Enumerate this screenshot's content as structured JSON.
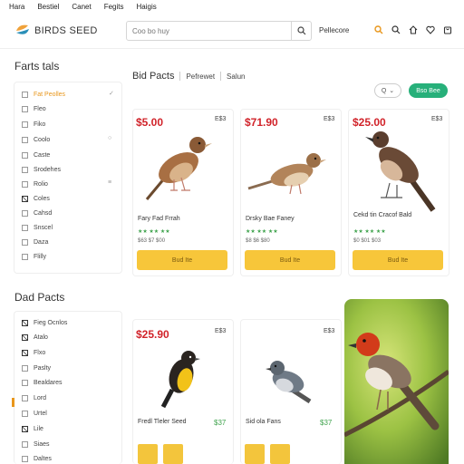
{
  "topnav": [
    "Hara",
    "Bestiel",
    "Canet",
    "Fegits",
    "Haigis"
  ],
  "header": {
    "logo_text": "BIRDS SEED",
    "search_placeholder": "Coo bo huy",
    "link": "Pellecore"
  },
  "filters1": {
    "title": "Farts tals",
    "items": [
      {
        "label": "Fat Peolles",
        "checked": false,
        "active": true,
        "extra": "✓"
      },
      {
        "label": "Fleo",
        "checked": false
      },
      {
        "label": "Fiko",
        "checked": false
      },
      {
        "label": "Coolo",
        "checked": false,
        "extra": "○"
      },
      {
        "label": "Caste",
        "checked": false
      },
      {
        "label": "Srodehes",
        "checked": false
      },
      {
        "label": "Rolio",
        "checked": false,
        "extra": "≡"
      },
      {
        "label": "Coles",
        "checked": true
      },
      {
        "label": "Cahsd",
        "checked": false
      },
      {
        "label": "Snscel",
        "checked": false
      },
      {
        "label": "Daza",
        "checked": false
      },
      {
        "label": "Flilly",
        "checked": false
      }
    ]
  },
  "tabs": {
    "main": "Bid Pacts",
    "items": [
      "Pefrewet",
      "Salun"
    ]
  },
  "sort_label": "Q",
  "pill_label": "Bso Bee",
  "products_row1": [
    {
      "price": "$5.00",
      "code": "E$3",
      "name": "Fary Fad Frrah",
      "rating": "★★ ★★ ★★",
      "meta": "$63 $7 $00",
      "buy": "Bud Ite"
    },
    {
      "price": "$71.90",
      "code": "E$3",
      "name": "Drsky Bae Faney",
      "rating": "★★ ★★ ★★",
      "meta": "$8 $6 $80",
      "buy": "Bud Ite"
    },
    {
      "price": "$25.00",
      "code": "E$3",
      "name": "Cekd tin Cracof Bald",
      "rating": "★★ ★★ ★★",
      "meta": "$0 $01 $03",
      "buy": "Bud Ite"
    }
  ],
  "filters2": {
    "title": "Dad Pacts",
    "items": [
      {
        "label": "Fieg Ocnlos",
        "checked": true
      },
      {
        "label": "Atalo",
        "checked": true
      },
      {
        "label": "Flxo",
        "checked": true
      },
      {
        "label": "Paslty",
        "checked": false
      },
      {
        "label": "Bealdares",
        "checked": false
      },
      {
        "label": "Lord",
        "checked": false
      },
      {
        "label": "Urtel",
        "checked": false
      },
      {
        "label": "Lile",
        "checked": true
      },
      {
        "label": "Siaes",
        "checked": false
      },
      {
        "label": "Daltes",
        "checked": false
      }
    ]
  },
  "products_row2": [
    {
      "price": "$25.90",
      "code": "E$3",
      "name": "Fredl Tleler Seed",
      "side_price": "$37"
    },
    {
      "price": "",
      "code": "E$3",
      "name": "Sid ola Fans",
      "side_price": "$37"
    }
  ],
  "colors": {
    "accent": "#27b07a",
    "price": "#d1232a",
    "buy": "#f7c63a",
    "active": "#e8961b"
  }
}
